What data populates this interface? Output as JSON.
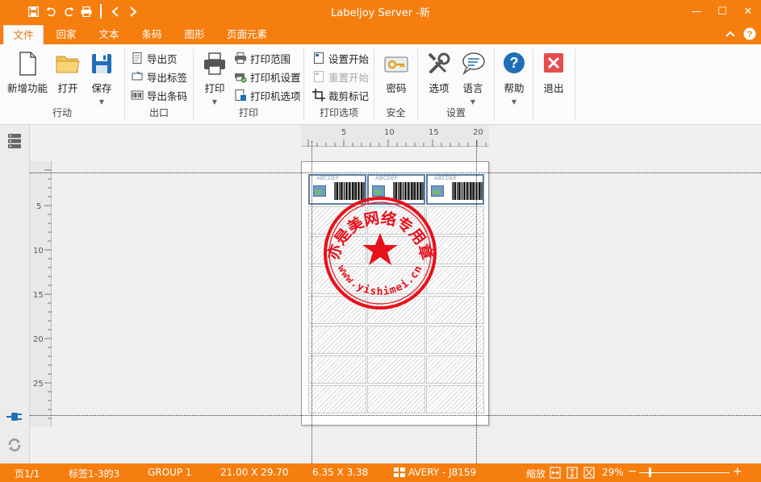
{
  "window": {
    "title": "Labeljoy Server -新",
    "controls": {
      "minimize": "—",
      "maximize": "☐",
      "close": "✕"
    }
  },
  "quick_access": [
    "save-icon",
    "undo-icon",
    "redo-icon",
    "print-icon",
    "back-icon",
    "forward-icon"
  ],
  "tabs": [
    {
      "label": "文件",
      "active": true
    },
    {
      "label": "回家"
    },
    {
      "label": "文本"
    },
    {
      "label": "条码"
    },
    {
      "label": "图形"
    },
    {
      "label": "页面元素"
    }
  ],
  "ribbon": {
    "groups": {
      "action": "行动",
      "export": "出口",
      "print": "打印",
      "print_options": "打印选项",
      "security": "安全",
      "settings": "设置"
    },
    "new_function": "新增功能",
    "open": "打开",
    "save": "保存",
    "export_page": "导出页",
    "export_label": "导出标签",
    "export_barcode": "导出条码",
    "print": "打印",
    "print_range": "打印范围",
    "printer_settings": "打印机设置",
    "printer_options": "打印机选项",
    "set_start": "设置开始",
    "reset_start": "重置开始",
    "crop_marks": "裁剪标记",
    "password": "密码",
    "options": "选项",
    "language": "语言",
    "help": "帮助",
    "exit": "退出"
  },
  "rulers": {
    "horizontal": [
      "5",
      "10",
      "15",
      "20"
    ],
    "vertical": [
      "5",
      "10",
      "15",
      "20",
      "25"
    ]
  },
  "label_tag": "ABCDEF",
  "stamp": {
    "top_text": "亦是美网络专用章",
    "bottom_text": "www.yishimei.cn",
    "color": "#e8101a"
  },
  "status": {
    "page": "页1/1",
    "labels": "标签1-3的3",
    "group": "GROUP 1",
    "page_size": "21.00 X 29.70",
    "label_size": "6.35 X 3.38",
    "template": "AVERY - J8159",
    "zoom_label": "缩放",
    "zoom_value": "29%"
  },
  "colors": {
    "accent": "#f57e0f",
    "label_border": "#5c7ea6"
  }
}
